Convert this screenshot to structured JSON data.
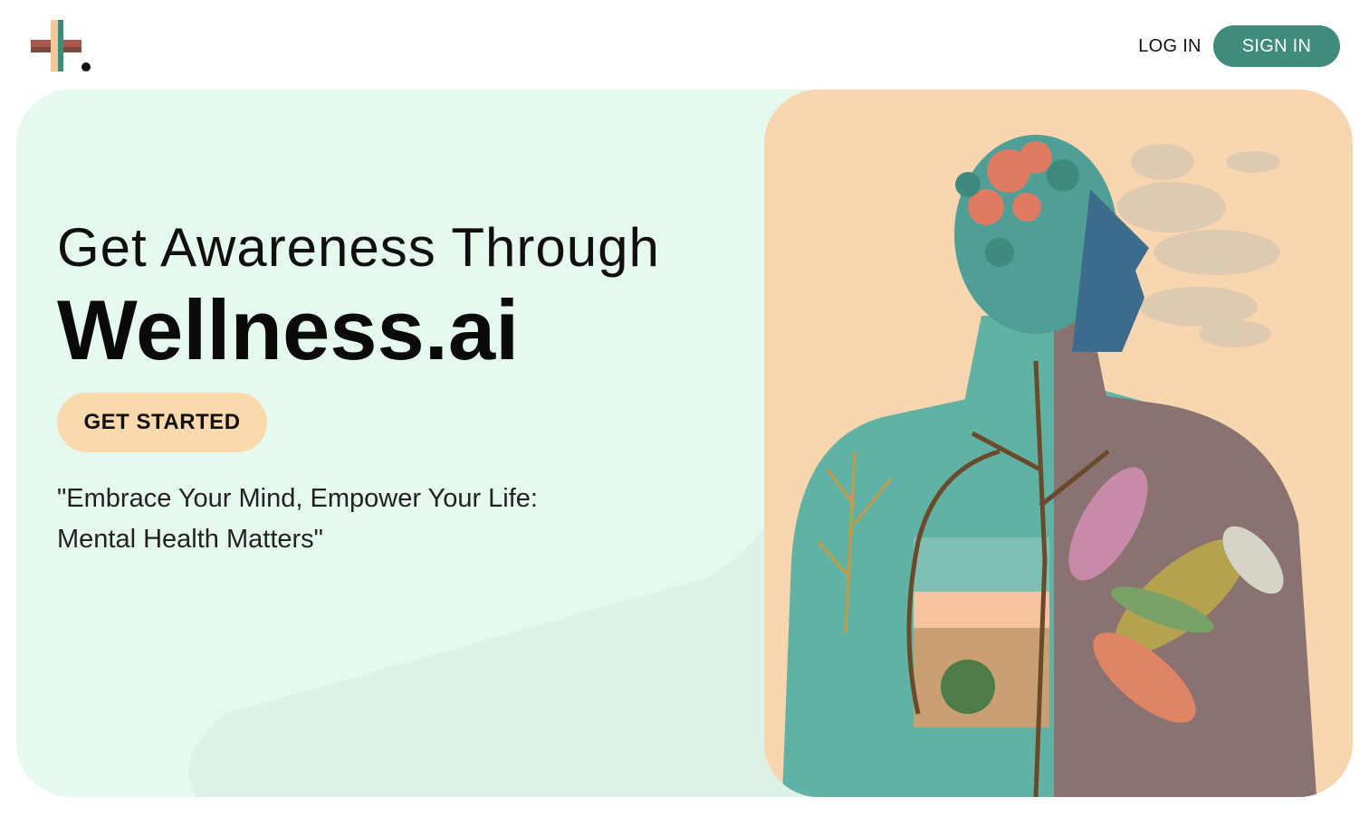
{
  "nav": {
    "login_label": "LOG IN",
    "signin_label": "SIGN IN"
  },
  "hero": {
    "headline_line1": "Get Awareness Through",
    "headline_line2": "Wellness.ai",
    "cta_label": "GET STARTED",
    "quote_line1": "\"Embrace Your Mind, Empower Your Life:",
    "quote_line2": " Mental Health Matters\""
  },
  "colors": {
    "accent_green": "#3f8c7b",
    "hero_bg": "#e6f9ef",
    "cta_bg": "#fcd8ad",
    "image_bg": "#f8d6b0"
  },
  "icons": {
    "logo": "plus-logo-icon",
    "hero_image": "human-anatomy-nature-illustration"
  }
}
